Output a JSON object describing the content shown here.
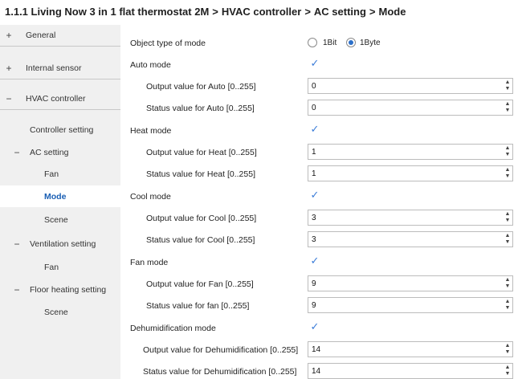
{
  "breadcrumb": {
    "parts": [
      "1.1.1 Living Now 3 in 1 flat thermostat 2M",
      "HVAC controller",
      "AC setting",
      "Mode"
    ],
    "separator": ">"
  },
  "sidebar": {
    "items": [
      {
        "symbol": "+",
        "label": "General"
      },
      {
        "symbol": "+",
        "label": "Internal sensor"
      },
      {
        "symbol": "−",
        "label": "HVAC controller"
      },
      {
        "symbol": "",
        "label": "Controller setting"
      },
      {
        "symbol": "−",
        "label": "AC setting"
      },
      {
        "symbol": "",
        "label": "Fan"
      },
      {
        "symbol": "",
        "label": "Mode"
      },
      {
        "symbol": "",
        "label": "Scene"
      },
      {
        "symbol": "−",
        "label": "Ventilation setting"
      },
      {
        "symbol": "",
        "label": "Fan"
      },
      {
        "symbol": "−",
        "label": "Floor heating setting"
      },
      {
        "symbol": "",
        "label": "Scene"
      }
    ]
  },
  "main": {
    "object_type": {
      "label": "Object type of mode",
      "options": [
        "1Bit",
        "1Byte"
      ],
      "selected": "1Byte"
    },
    "rows": [
      {
        "label": "Auto mode",
        "checked": true
      },
      {
        "label": "Output value for Auto [0..255]",
        "value": "0"
      },
      {
        "label": "Status value for Auto [0..255]",
        "value": "0"
      },
      {
        "label": "Heat mode",
        "checked": true
      },
      {
        "label": "Output value for Heat [0..255]",
        "value": "1"
      },
      {
        "label": "Status value for Heat [0..255]",
        "value": "1"
      },
      {
        "label": "Cool mode",
        "checked": true
      },
      {
        "label": "Output value for Cool [0..255]",
        "value": "3"
      },
      {
        "label": "Status value for Cool [0..255]",
        "value": "3"
      },
      {
        "label": "Fan mode",
        "checked": true
      },
      {
        "label": "Output value for Fan [0..255]",
        "value": "9"
      },
      {
        "label": "Status value for fan [0..255]",
        "value": "9"
      },
      {
        "label": "Dehumidification mode",
        "checked": true
      },
      {
        "label": "Output value for Dehumidification [0..255]",
        "value": "14"
      },
      {
        "label": "Status value for Dehumidification [0..255]",
        "value": "14"
      }
    ]
  },
  "icons": {
    "check": "checkmark-icon",
    "spin_up": "spin-up-icon",
    "spin_down": "spin-down-icon"
  },
  "colors": {
    "accent": "#1a5fb4",
    "sidebar_bg": "#f0f0f0"
  }
}
